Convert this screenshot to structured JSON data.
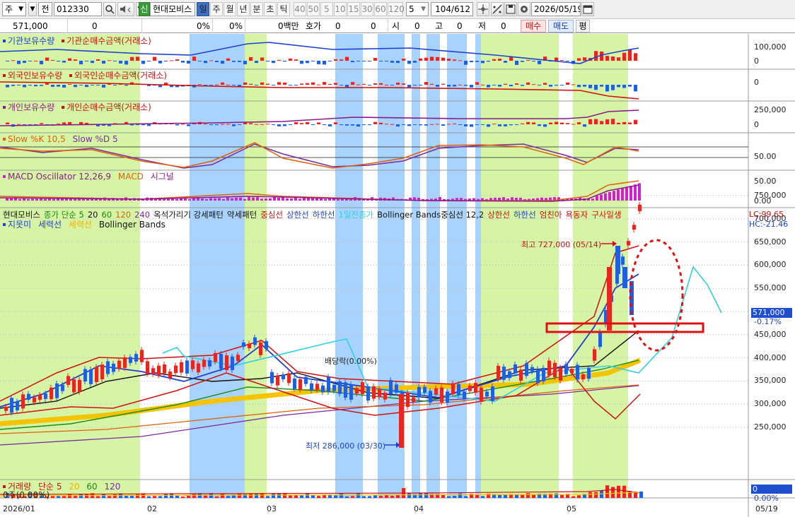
{
  "toolbar": {
    "market": "주",
    "prev_label": "전",
    "code": "012330",
    "new_badge": "신",
    "stock_name": "현대모비스",
    "periods": [
      {
        "label": "일",
        "active": true
      },
      {
        "label": "주",
        "active": false
      },
      {
        "label": "월",
        "active": false
      },
      {
        "label": "년",
        "active": false
      },
      {
        "label": "분",
        "active": false
      },
      {
        "label": "초",
        "active": false
      },
      {
        "label": "틱",
        "active": false
      }
    ],
    "intervals": [
      "40",
      "50",
      "5",
      "10",
      "15",
      "30",
      "60",
      "120"
    ],
    "interval_select": "5",
    "count": "104",
    "count_total": "/612",
    "date": "2026/05/19"
  },
  "quote": {
    "price": "571,000",
    "change": "0",
    "rate1": "0%",
    "rate2": "0%",
    "amount": "0백만",
    "ask_label": "호가",
    "ask_val1": "0",
    "ask_val2": "0",
    "open_label": "시",
    "open_val": "0",
    "high_label": "고",
    "high_val": "0",
    "low_label": "저",
    "low_val": "0",
    "buy": "매수",
    "sell": "매도",
    "eval": "평"
  },
  "panels": {
    "inst_legend": [
      "기관보유수량",
      "기관순매수금액(거래소)"
    ],
    "foreign_legend": [
      "외국인보유수량",
      "외국인순매수금액(거래소)"
    ],
    "indiv_legend": [
      "개인보유수량",
      "개인순매수금액(거래소)"
    ],
    "slow_legend": [
      "Slow %K 10,5",
      "Slow %D 5"
    ],
    "macd_legend": [
      "MACD Oscillator 12,26,9",
      "MACD",
      "시그널"
    ],
    "price_legend_row1": [
      "현대모비스",
      "종가 단순 5",
      "20",
      "60",
      "120",
      "240",
      "옥석가리기 강세패턴",
      "약세패턴",
      "중심선",
      "상한선",
      "하한선",
      "1일전종가",
      "Bollinger Bands중심선 12,2",
      "상한선",
      "하한선",
      "엄친아",
      "욕동자",
      "구사일생"
    ],
    "price_legend_row2": [
      "지못미",
      "세력선",
      "세력선",
      "Bollinger Bands"
    ],
    "vol_legend": [
      "거래량",
      "단순 5",
      "20",
      "60",
      "120"
    ],
    "vol_sub": "0주(0.00%)"
  },
  "axes": {
    "inst": [
      "100,000",
      "0"
    ],
    "foreign": [
      "0"
    ],
    "indiv": [
      "250,000",
      "0"
    ],
    "slow": [
      "50.00"
    ],
    "macd": [
      "50.00",
      "0.00"
    ],
    "price": [
      "750,000",
      "700,000",
      "650,000",
      "600,000",
      "550,000",
      "500,000",
      "450,000",
      "400,000",
      "350,000",
      "300,000",
      "250,000"
    ],
    "price_current": "571,000",
    "price_change": "-0.17%",
    "lc": "LC:99.65",
    "hc": "HC:-21.46",
    "vol": [
      "0",
      "0.00%"
    ],
    "dates": [
      "2026/01",
      "02",
      "03",
      "04",
      "05",
      "05/19"
    ]
  },
  "annotations": {
    "high": "최고 727,000 (05/14)",
    "low": "최저 286,000 (03/30)",
    "dividend": "배당락(0.00%)"
  },
  "colors": {
    "green_band": "#d6f5a4",
    "blue_band": "#a8d3ff",
    "up": "#e8251f",
    "down": "#1f5fe0"
  }
}
